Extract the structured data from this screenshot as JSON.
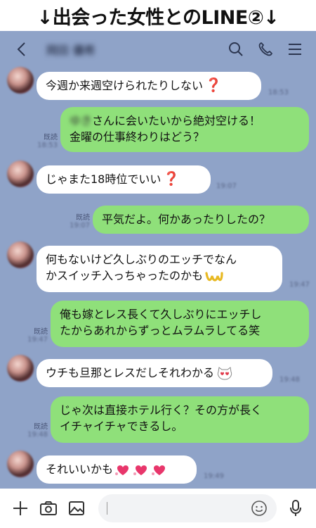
{
  "banner": {
    "title": "↓出会った女性とのLINE②↓"
  },
  "header": {
    "contact_name": "岡田 優希"
  },
  "messages": {
    "m1": {
      "text": "今週か来週空けられたりしない",
      "emoji": "❓"
    },
    "m2": {
      "name_blur": "ゆき",
      "line1": "さんに会いたいから絶対空ける！",
      "line2": "金曜の仕事終わりはどう？",
      "read": "既読"
    },
    "m3": {
      "text": "じゃまた18時位でいい",
      "emoji": "❓"
    },
    "m4": {
      "text": "平気だよ。何かあったりしたの？",
      "read": "既読"
    },
    "m5": {
      "line1": "何もないけど久しぶりのエッチでなん",
      "line2": "かスイッチ入っちゃったのかも"
    },
    "m6": {
      "line1": "俺も嫁とレス長くて久しぶりにエッチし",
      "line2": "たからあれからずっとムラムラしてる笑",
      "read": "既読"
    },
    "m7": {
      "text": "ウチも旦那とレスだしそれわかる"
    },
    "m8": {
      "line1": "じゃ次は直接ホテル行く？その方が長く",
      "line2": "イチャイチャできるし。",
      "read": "既読"
    },
    "m9": {
      "text": "それいいかも"
    }
  },
  "times": [
    "18:53",
    "18:53",
    "19:07",
    "19:07",
    "19:47",
    "19:47",
    "19:48",
    "19:48",
    "19:49"
  ],
  "colors": {
    "chat_bg": "#8fa3c8",
    "outgoing": "#8fe07a",
    "incoming": "#ffffff"
  }
}
